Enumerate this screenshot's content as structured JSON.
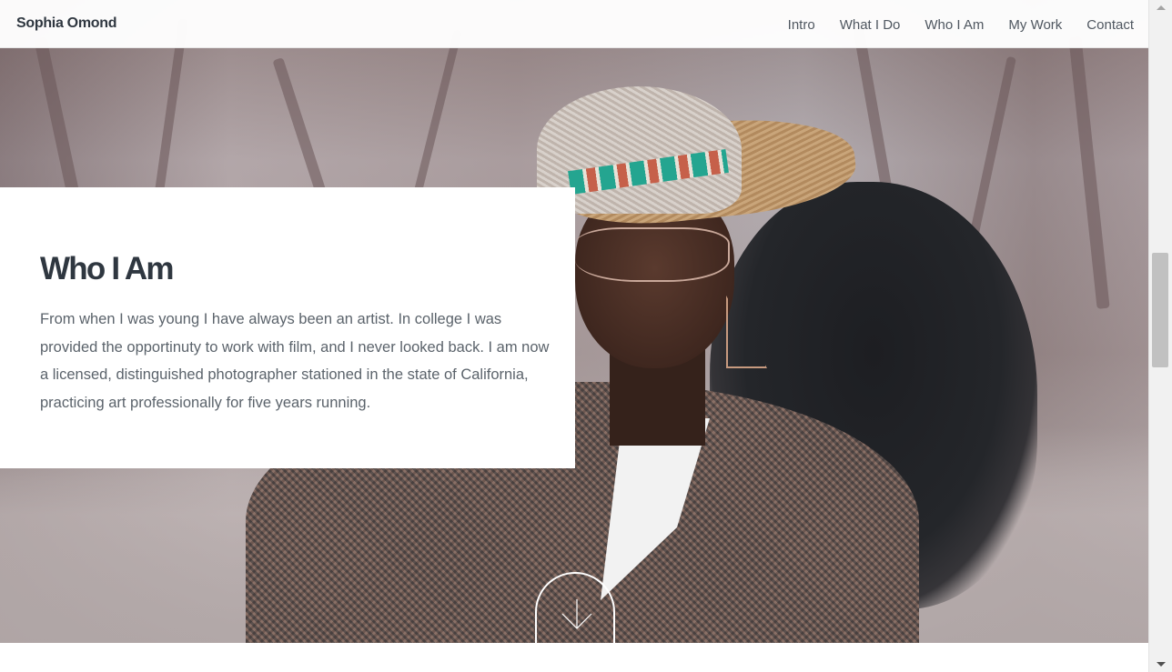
{
  "site": {
    "brand": "Sophia Omond"
  },
  "nav": {
    "items": [
      {
        "label": "Intro"
      },
      {
        "label": "What I Do"
      },
      {
        "label": "Who I Am"
      },
      {
        "label": "My Work"
      },
      {
        "label": "Contact"
      }
    ]
  },
  "section": {
    "title": "Who I Am",
    "body": "From when I was young I have always been an artist. In college I was provided the opportinuty to work with film, and I never looked back. I am now a licensed, distinguished photographer stationed in the state of California, practicing art professionally for five years running."
  },
  "hero": {
    "image": "portrait-photo",
    "scroll_icon": "chevron-down-icon"
  },
  "colors": {
    "heading": "#2f3740",
    "body_text": "#5b636b",
    "nav_text": "#4f5760"
  }
}
